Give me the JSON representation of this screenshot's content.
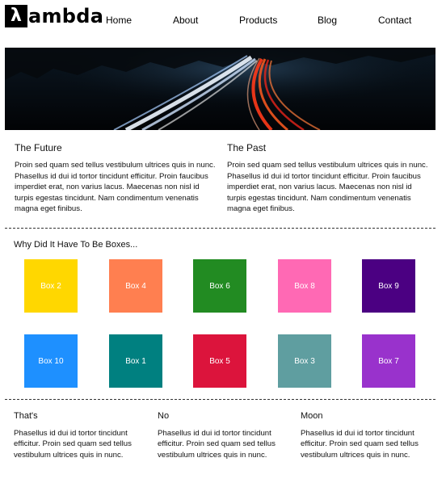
{
  "brand": {
    "logo_symbol": "λ",
    "name": "ambda"
  },
  "nav": {
    "items": [
      {
        "label": "Home"
      },
      {
        "label": "About"
      },
      {
        "label": "Products"
      },
      {
        "label": "Blog"
      },
      {
        "label": "Contact"
      }
    ]
  },
  "sections": [
    {
      "title": "The Future",
      "body": "Proin sed quam sed tellus vestibulum ultrices quis in nunc. Phasellus id dui id tortor tincidunt efficitur. Proin faucibus imperdiet erat, non varius lacus. Maecenas non nisl id turpis egestas tincidunt. Nam condimentum venenatis magna eget finibus."
    },
    {
      "title": "The Past",
      "body": "Proin sed quam sed tellus vestibulum ultrices quis in nunc. Phasellus id dui id tortor tincidunt efficitur. Proin faucibus imperdiet erat, non varius lacus. Maecenas non nisl id turpis egestas tincidunt. Nam condimentum venenatis magna eget finibus."
    }
  ],
  "boxes_section": {
    "title": "Why Did It Have To Be Boxes...",
    "boxes": [
      {
        "label": "Box 2",
        "color": "#FFD700"
      },
      {
        "label": "Box 4",
        "color": "#FF7F50"
      },
      {
        "label": "Box 6",
        "color": "#228B22"
      },
      {
        "label": "Box 8",
        "color": "#FF69B4"
      },
      {
        "label": "Box 9",
        "color": "#4B0082"
      },
      {
        "label": "Box 10",
        "color": "#1E90FF"
      },
      {
        "label": "Box 1",
        "color": "#008080"
      },
      {
        "label": "Box 5",
        "color": "#DC143C"
      },
      {
        "label": "Box 3",
        "color": "#5F9EA0"
      },
      {
        "label": "Box 7",
        "color": "#9932CC"
      }
    ]
  },
  "footer_columns": [
    {
      "title": "That's",
      "body": "Phasellus id dui id tortor tincidunt efficitur. Proin sed quam sed tellus vestibulum ultrices quis in nunc."
    },
    {
      "title": "No",
      "body": "Phasellus id dui id tortor tincidunt efficitur. Proin sed quam sed tellus vestibulum ultrices quis in nunc."
    },
    {
      "title": "Moon",
      "body": "Phasellus id dui id tortor tincidunt efficitur. Proin sed quam sed tellus vestibulum ultrices quis in nunc."
    }
  ]
}
